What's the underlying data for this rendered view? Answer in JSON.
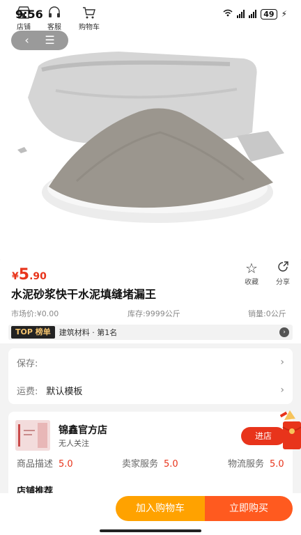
{
  "status_bar": {
    "time": "9:56",
    "battery": "49",
    "icons": [
      "wifi-icon",
      "signal-icon",
      "signal-icon",
      "battery-icon",
      "charging-icon"
    ]
  },
  "nav": {
    "back_icon": "chevron-left-icon",
    "menu_icon": "menu-icon"
  },
  "product": {
    "price_symbol": "¥",
    "price_int": "5",
    "price_dec": ".90",
    "title": "水泥砂浆快干水泥填缝堵漏王",
    "market_price": "市场价:¥0.00",
    "stock": "库存:9999公斤",
    "sales": "销量:0公斤",
    "favorite_label": "收藏",
    "share_label": "分享"
  },
  "ranking": {
    "tag": "TOP 榜单",
    "text": "建筑材料 · 第1名"
  },
  "options": {
    "protect_label": "保存:",
    "shipping_label": "运费:",
    "shipping_value": "默认模板"
  },
  "store": {
    "name": "锦鑫官方店",
    "followers": "无人关注",
    "enter_label": "进店",
    "scores": [
      {
        "label": "商品描述",
        "value": "5.0"
      },
      {
        "label": "卖家服务",
        "value": "5.0"
      },
      {
        "label": "物流服务",
        "value": "5.0"
      }
    ],
    "recommend_label": "店铺推荐"
  },
  "bottom_bar": {
    "tabs": [
      {
        "label": "店铺",
        "icon": "store-icon"
      },
      {
        "label": "客服",
        "icon": "headset-icon"
      },
      {
        "label": "购物车",
        "icon": "cart-icon"
      }
    ],
    "add_to_cart": "加入购物车",
    "buy_now": "立即购买"
  },
  "colors": {
    "accent": "#e8341b",
    "cart": "#ffa200",
    "buy": "#ff5a1f"
  }
}
